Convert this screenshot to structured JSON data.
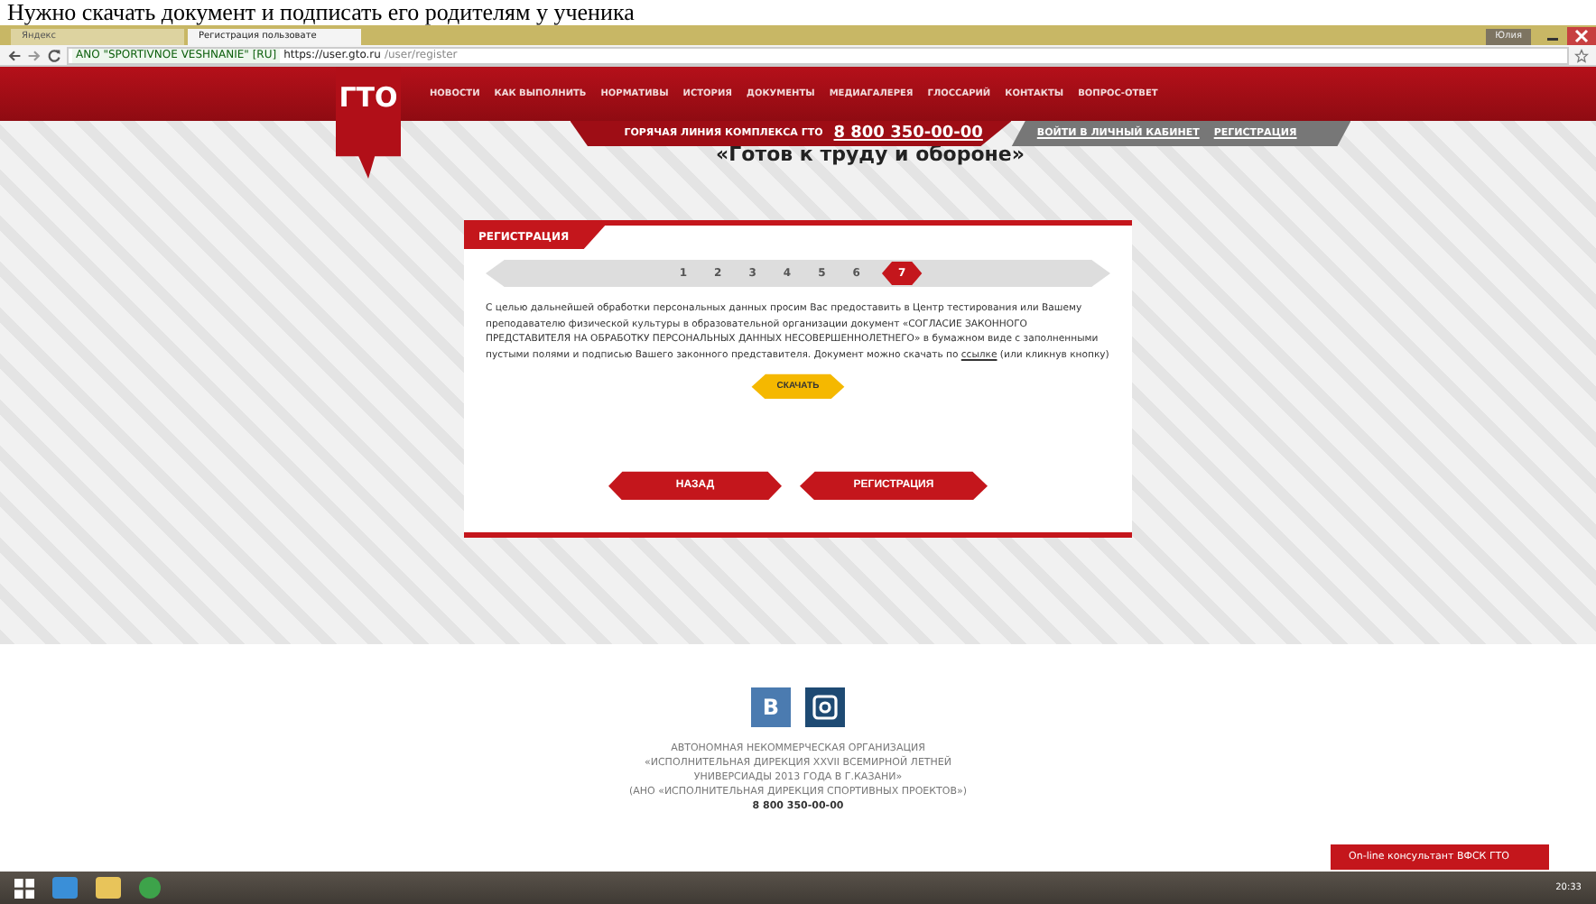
{
  "caption": "Нужно скачать документ и подписать его родителям у ученика",
  "browser": {
    "tabs": [
      {
        "label": "Яндекс",
        "selected": false
      },
      {
        "label": "Регистрация пользовате",
        "selected": true
      }
    ],
    "user": "Юлия",
    "cert": "ANO \"SPORTIVNOE VESHNANIE\" [RU]",
    "url_host": "https://user.gto.ru",
    "url_path": "/user/register"
  },
  "site": {
    "logo": "ГТО",
    "nav": [
      "НОВОСТИ",
      "КАК ВЫПОЛНИТЬ",
      "НОРМАТИВЫ",
      "ИСТОРИЯ",
      "ДОКУМЕНТЫ",
      "МЕДИАГАЛЕРЕЯ",
      "ГЛОССАРИЙ",
      "КОНТАКТЫ",
      "ВОПРОС-ОТВЕТ"
    ],
    "hotline_label": "ГОРЯЧАЯ ЛИНИЯ КОМПЛЕКСА ГТО",
    "hotline_phone": "8 800 350-00-00",
    "login": "ВОЙТИ В ЛИЧНЫЙ КАБИНЕТ",
    "register": "РЕГИСТРАЦИЯ",
    "slogan": "«Готов к труду и обороне»"
  },
  "card": {
    "title": "РЕГИСТРАЦИЯ",
    "steps": [
      {
        "label": "1",
        "selected": false
      },
      {
        "label": "2",
        "selected": false
      },
      {
        "label": "3",
        "selected": false
      },
      {
        "label": "4",
        "selected": false
      },
      {
        "label": "5",
        "selected": false
      },
      {
        "label": "6",
        "selected": false
      },
      {
        "label": "7",
        "selected": true
      }
    ],
    "text_before": "С целью дальнейшей обработки персональных данных просим Вас предоставить в Центр тестирования или Вашему преподавателю физической культуры в образовательной организации документ «СОГЛАСИЕ ЗАКОННОГО ПРЕДСТАВИТЕЛЯ НА ОБРАБОТКУ ПЕРСОНАЛЬНЫХ ДАННЫХ НЕСОВЕРШЕННОЛЕТНЕГО» в бумажном виде с заполненными пустыми полями и подписью Вашего законного представителя. Документ можно скачать по",
    "link": "ссылке",
    "text_after": "(или кликнув кнопку)",
    "download": "СКАЧАТЬ",
    "back": "НАЗАД",
    "submit": "РЕГИСТРАЦИЯ"
  },
  "footer": {
    "social": [
      {
        "kind": "vk",
        "label": "В"
      },
      {
        "kind": "instagram"
      }
    ],
    "lines": [
      "АВТОНОМНАЯ НЕКОММЕРЧЕСКАЯ ОРГАНИЗАЦИЯ",
      "«ИСПОЛНИТЕЛЬНАЯ ДИРЕКЦИЯ XXVII ВСЕМИРНОЙ ЛЕТНЕЙ",
      "УНИВЕРСИАДЫ 2013 ГОДА В Г.КАЗАНИ»",
      "(АНО «ИСПОЛНИТЕЛЬНАЯ ДИРЕКЦИЯ СПОРТИВНЫХ ПРОЕКТОВ»)"
    ],
    "phone": "8 800 350-00-00"
  },
  "consultant": "On-line консультант ВФСК ГТО",
  "taskbar": {
    "clock": "20:33"
  }
}
